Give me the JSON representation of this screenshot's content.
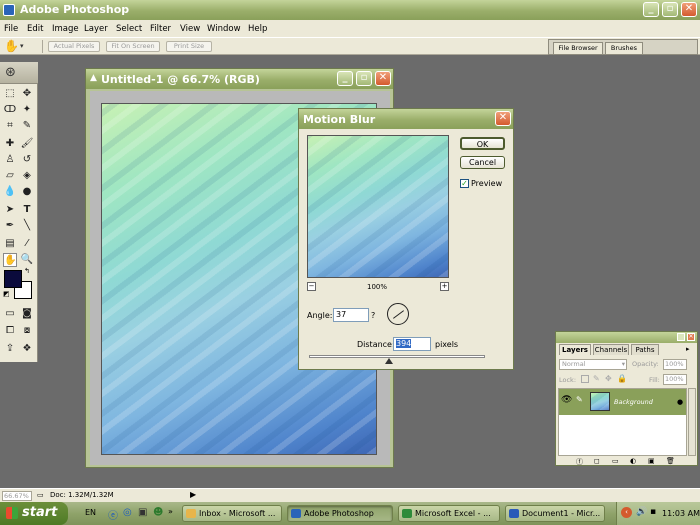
{
  "app": {
    "title": "Adobe Photoshop",
    "menu": [
      "File",
      "Edit",
      "Image",
      "Layer",
      "Select",
      "Filter",
      "View",
      "Window",
      "Help"
    ]
  },
  "options_bar": {
    "buttons": [
      "Actual Pixels",
      "Fit On Screen",
      "Print Size"
    ],
    "palette_well_tabs": [
      "File Browser",
      "Brushes"
    ]
  },
  "document": {
    "title": "Untitled-1 @ 66.7% (RGB)"
  },
  "dialog": {
    "title": "Motion Blur",
    "ok_label": "OK",
    "cancel_label": "Cancel",
    "preview_label": "Preview",
    "preview_checked": true,
    "zoom_label": "100%",
    "zoom_out": "−",
    "zoom_in": "+",
    "angle_label": "Angle:",
    "angle_value": "37",
    "angle_unit": "?",
    "distance_label": "Distance:",
    "distance_value": "394",
    "distance_unit": "pixels"
  },
  "layers_panel": {
    "tabs": [
      "Layers",
      "Channels",
      "Paths"
    ],
    "blend_mode": "Normal",
    "opacity_label": "Opacity:",
    "opacity_value": "100%",
    "lock_label": "Lock:",
    "fill_label": "Fill:",
    "fill_value": "100%",
    "layer_name": "Background"
  },
  "status": {
    "zoom": "66.67%",
    "doc_info": "Doc: 1.32M/1.32M"
  },
  "taskbar": {
    "start_label": "start",
    "lang": "EN",
    "tasks": [
      "Inbox - Microsoft ...",
      "Adobe Photoshop",
      "Microsoft Excel - ...",
      "Document1 - Micr..."
    ],
    "clock": "11:03 AM"
  },
  "colors": {
    "foreground": "#0b0b3c",
    "background": "#ffffff"
  }
}
